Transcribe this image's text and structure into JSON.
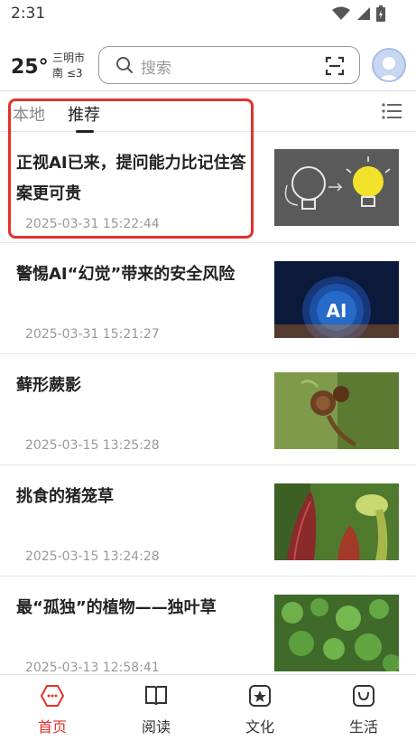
{
  "status": {
    "time": "2:31",
    "icons": [
      "wifi-icon",
      "signal-icon",
      "battery-icon"
    ]
  },
  "header": {
    "temperature": "25°",
    "city": "三明市",
    "wind": "南 ≤3",
    "search_placeholder": "搜索",
    "icons": [
      "search-icon",
      "scan-icon",
      "avatar"
    ]
  },
  "tabs": {
    "items": [
      {
        "label": "本地",
        "active": false
      },
      {
        "label": "推荐",
        "active": true
      }
    ],
    "menu_icon": "list-menu-icon"
  },
  "news": [
    {
      "title": "正视AI已来，提问能力比记住答案更可贵",
      "date": "2025-03-31 15:22:44",
      "thumb": "lightbulb-chalk-image"
    },
    {
      "title": "警惕AI“幻觉”带来的安全风险",
      "date": "2025-03-31 15:21:27",
      "thumb": "ai-sphere-image"
    },
    {
      "title": "藓形蕨影",
      "date": "2025-03-15 13:25:28",
      "thumb": "fern-curl-image"
    },
    {
      "title": "挑食的猪笼草",
      "date": "2025-03-15 13:24:28",
      "thumb": "pitcher-plant-image"
    },
    {
      "title": "最“孤独”的植物——独叶草",
      "date": "2025-03-13 12:58:41",
      "thumb": "green-leaves-image"
    }
  ],
  "bottom_nav": [
    {
      "label": "首页",
      "icon": "home-icon",
      "active": true
    },
    {
      "label": "阅读",
      "icon": "book-icon",
      "active": false
    },
    {
      "label": "文化",
      "icon": "star-badge-icon",
      "active": false
    },
    {
      "label": "生活",
      "icon": "smile-bag-icon",
      "active": false
    }
  ],
  "colors": {
    "accent": "#e2322c",
    "text": "#222222",
    "muted": "#999999"
  }
}
